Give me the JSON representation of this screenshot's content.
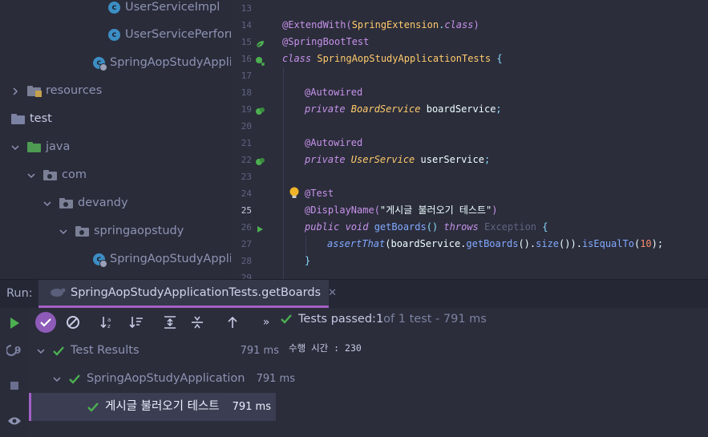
{
  "project_tree": {
    "items": [
      {
        "label": "UserServiceImpl",
        "icon": "java-class-icon"
      },
      {
        "label": "UserServicePerform",
        "icon": "java-class-icon"
      },
      {
        "label": "SpringAopStudyApplic",
        "icon": "spring-boot-class-icon"
      },
      {
        "label": "resources",
        "icon": "resources-folder-icon"
      },
      {
        "label": "test",
        "icon": "test-folder-icon"
      },
      {
        "label": "java",
        "icon": "test-sources-folder-icon"
      },
      {
        "label": "com",
        "icon": "package-icon"
      },
      {
        "label": "devandy",
        "icon": "package-icon"
      },
      {
        "label": "springaopstudy",
        "icon": "package-icon"
      },
      {
        "label": "SpringAopStudyApplic",
        "icon": "spring-boot-class-icon"
      }
    ]
  },
  "editor": {
    "line_numbers": [
      "13",
      "14",
      "15",
      "16",
      "17",
      "18",
      "19",
      "20",
      "21",
      "22",
      "23",
      "24",
      "25",
      "26",
      "27",
      "28",
      "29"
    ],
    "current_line": "25",
    "code": {
      "l14": {
        "a": "@ExtendWith(",
        "b": "SpringExtension",
        "c": ".",
        "d": "class",
        "e": ")"
      },
      "l15": {
        "a": "@SpringBootTest"
      },
      "l16": {
        "a": "class ",
        "b": "SpringAopStudyApplicationTests",
        "c": " {"
      },
      "l18": {
        "a": "@Autowired"
      },
      "l19": {
        "a": "private ",
        "b": "BoardService",
        "c": " boardService",
        "d": ";"
      },
      "l21": {
        "a": "@Autowired"
      },
      "l22": {
        "a": "private ",
        "b": "UserService",
        "c": " userService",
        "d": ";"
      },
      "l24": {
        "a": "@Test"
      },
      "l25": {
        "a": "@DisplayName(",
        "b": "\"게시글 불러오기 테스트\"",
        "c": ")"
      },
      "l26": {
        "a": "public ",
        "b": "void ",
        "c": "getBoards",
        "d": "() ",
        "e": "throws ",
        "f": "Exception",
        "g": " {"
      },
      "l27": {
        "a": "assertThat",
        "b": "(boardService.",
        "c": "getBoards",
        "d": "().",
        "e": "size",
        "f": "()).",
        "g": "isEqualTo",
        "h": "(",
        "i": "10",
        "j": ");"
      },
      "l28": {
        "a": "}"
      }
    }
  },
  "run_panel": {
    "label": "Run:",
    "tab_title": "SpringAopStudyApplicationTests.getBoards",
    "status": {
      "prefix": "Tests passed: ",
      "count": "1",
      "suffix": " of 1 test - 791 ms"
    },
    "output": "수행 시간 : 230",
    "results": [
      {
        "label": "Test Results",
        "time": "791 ms"
      },
      {
        "label": "SpringAopStudyApplication",
        "time": "791 ms"
      },
      {
        "label": "게시글 불러오기 테스트",
        "time": "791 ms"
      }
    ]
  },
  "colors": {
    "accent": "#a45fc6",
    "pass_green": "#4caf50",
    "run_green": "#4caf50",
    "background": "#2b2d3b"
  }
}
